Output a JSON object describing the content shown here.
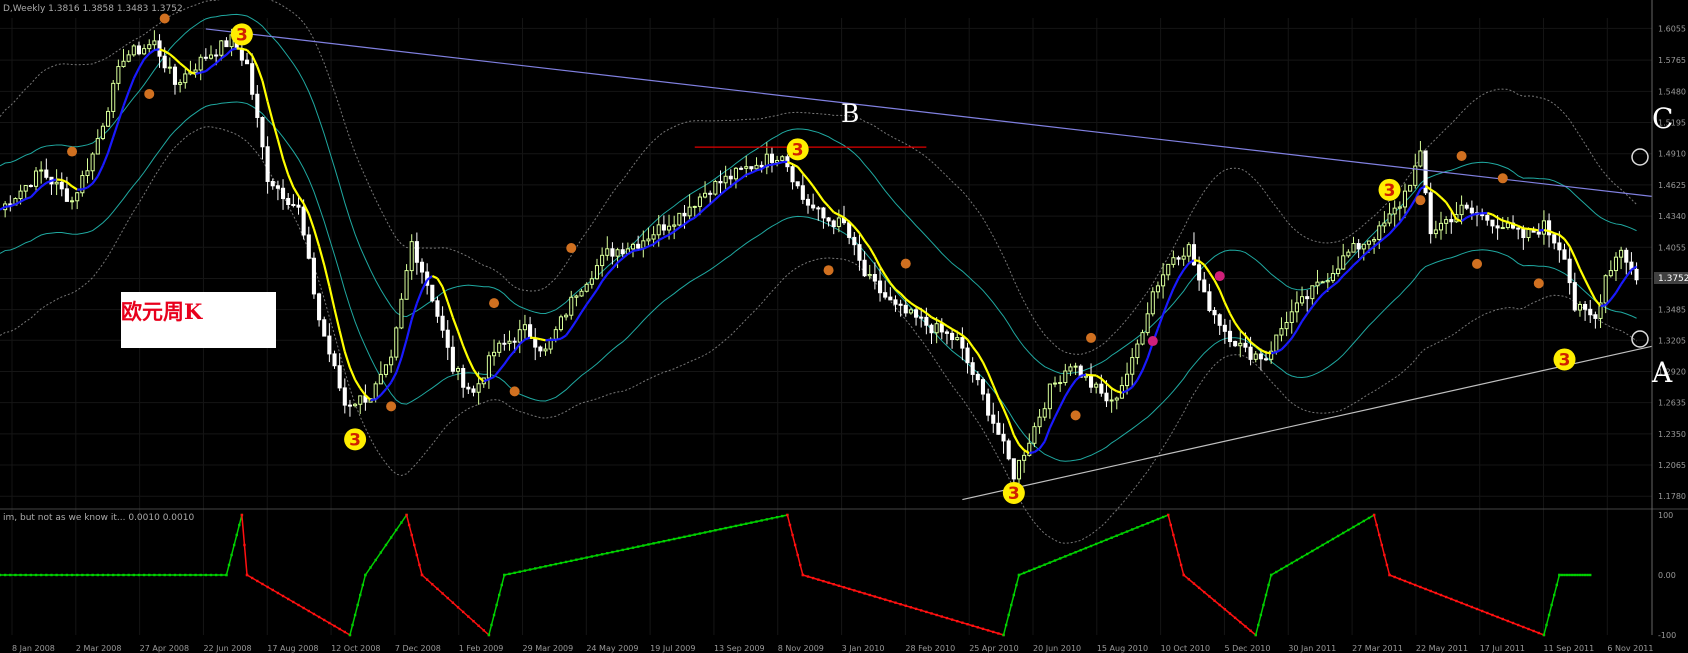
{
  "symbol_header": "D,Weekly  1.3816 1.3858 1.3483 1.3752",
  "indicator_header": "im, but not as we know it... 0.0010 0.0010",
  "annotation_box": "欧元周K",
  "labels": {
    "A": "A",
    "B": "B",
    "C": "C"
  },
  "pivot_marker_text": "3",
  "colors": {
    "background": "#000000",
    "bull_candle": "#d8ff9a",
    "bear_candle": "#ffffff",
    "ma_rising": "#1a1aff",
    "ma_falling": "#ffff00",
    "envelope": "#1fa8a0",
    "bollinger": "#777777",
    "resistance_trendline": "#8080e0",
    "support_trendline": "#c0c0c0",
    "b_level_line": "#e00000",
    "osc_up": "#00d000",
    "osc_down": "#ff1010",
    "price_label_box": "#404040"
  },
  "chart_data": [
    {
      "type": "candlestick",
      "panel": "price",
      "ylim": [
        1.17,
        1.615
      ],
      "y_ticks": [
        "1.6055",
        "1.5765",
        "1.5480",
        "1.5195",
        "1.4910",
        "1.4625",
        "1.4340",
        "1.4055",
        "1.3770",
        "1.3485",
        "1.3205",
        "1.2920",
        "1.2635",
        "1.2350",
        "1.2065",
        "1.1780"
      ],
      "current_price_label": "1.3752",
      "x_tick_labels": [
        "8 Jan 2008",
        "2 Mar 2008",
        "27 Apr 2008",
        "22 Jun 2008",
        "17 Aug 2008",
        "12 Oct 2008",
        "7 Dec 2008",
        "1 Feb 2009",
        "29 Mar 2009",
        "24 May 2009",
        "19 Jul 2009",
        "13 Sep 2009",
        "8 Nov 2009",
        "3 Jan 2010",
        "28 Feb 2010",
        "25 Apr 2010",
        "20 Jun 2010",
        "15 Aug 2010",
        "10 Oct 2010",
        "5 Dec 2010",
        "30 Jan 2011",
        "27 Mar 2011",
        "22 May 2011",
        "17 Jul 2011",
        "11 Sep 2011",
        "6 Nov 2011"
      ],
      "close_path": [
        {
          "week": 0,
          "close": 1.44
        },
        {
          "week": 8,
          "close": 1.475
        },
        {
          "week": 14,
          "close": 1.448
        },
        {
          "week": 18,
          "close": 1.49
        },
        {
          "week": 24,
          "close": 1.58
        },
        {
          "week": 30,
          "close": 1.592
        },
        {
          "week": 34,
          "close": 1.555
        },
        {
          "week": 40,
          "close": 1.58
        },
        {
          "week": 45,
          "close": 1.595
        },
        {
          "week": 48,
          "close": 1.572
        },
        {
          "week": 52,
          "close": 1.47
        },
        {
          "week": 58,
          "close": 1.44
        },
        {
          "week": 62,
          "close": 1.34
        },
        {
          "week": 67,
          "close": 1.262
        },
        {
          "week": 72,
          "close": 1.27
        },
        {
          "week": 76,
          "close": 1.3
        },
        {
          "week": 80,
          "close": 1.41
        },
        {
          "week": 84,
          "close": 1.36
        },
        {
          "week": 88,
          "close": 1.295
        },
        {
          "week": 92,
          "close": 1.272
        },
        {
          "week": 96,
          "close": 1.31
        },
        {
          "week": 102,
          "close": 1.33
        },
        {
          "week": 106,
          "close": 1.31
        },
        {
          "week": 112,
          "close": 1.365
        },
        {
          "week": 118,
          "close": 1.4
        },
        {
          "week": 124,
          "close": 1.41
        },
        {
          "week": 132,
          "close": 1.435
        },
        {
          "week": 138,
          "close": 1.46
        },
        {
          "week": 146,
          "close": 1.48
        },
        {
          "week": 152,
          "close": 1.492
        },
        {
          "week": 156,
          "close": 1.45
        },
        {
          "week": 160,
          "close": 1.432
        },
        {
          "week": 164,
          "close": 1.426
        },
        {
          "week": 168,
          "close": 1.38
        },
        {
          "week": 174,
          "close": 1.35
        },
        {
          "week": 180,
          "close": 1.335
        },
        {
          "week": 186,
          "close": 1.32
        },
        {
          "week": 190,
          "close": 1.28
        },
        {
          "week": 194,
          "close": 1.235
        },
        {
          "week": 197,
          "close": 1.198
        },
        {
          "week": 200,
          "close": 1.23
        },
        {
          "week": 204,
          "close": 1.275
        },
        {
          "week": 208,
          "close": 1.3
        },
        {
          "week": 212,
          "close": 1.28
        },
        {
          "week": 216,
          "close": 1.262
        },
        {
          "week": 220,
          "close": 1.3
        },
        {
          "week": 224,
          "close": 1.365
        },
        {
          "week": 228,
          "close": 1.398
        },
        {
          "week": 231,
          "close": 1.405
        },
        {
          "week": 234,
          "close": 1.36
        },
        {
          "week": 238,
          "close": 1.33
        },
        {
          "week": 242,
          "close": 1.31
        },
        {
          "week": 246,
          "close": 1.305
        },
        {
          "week": 250,
          "close": 1.34
        },
        {
          "week": 256,
          "close": 1.37
        },
        {
          "week": 262,
          "close": 1.4
        },
        {
          "week": 268,
          "close": 1.42
        },
        {
          "week": 272,
          "close": 1.445
        },
        {
          "week": 276,
          "close": 1.488
        },
        {
          "week": 278,
          "close": 1.42
        },
        {
          "week": 284,
          "close": 1.44
        },
        {
          "week": 290,
          "close": 1.43
        },
        {
          "week": 296,
          "close": 1.415
        },
        {
          "week": 300,
          "close": 1.425
        },
        {
          "week": 304,
          "close": 1.4
        },
        {
          "week": 306,
          "close": 1.35
        },
        {
          "week": 310,
          "close": 1.34
        },
        {
          "week": 312,
          "close": 1.38
        },
        {
          "week": 315,
          "close": 1.405
        },
        {
          "week": 318,
          "close": 1.375
        }
      ],
      "pivots_3": [
        {
          "week": 47,
          "price": 1.6,
          "type": "high"
        },
        {
          "week": 69,
          "price": 1.23,
          "type": "low"
        },
        {
          "week": 155,
          "price": 1.495,
          "type": "high"
        },
        {
          "week": 197,
          "price": 1.181,
          "type": "low"
        },
        {
          "week": 270,
          "price": 1.458,
          "type": "high"
        },
        {
          "week": 304,
          "price": 1.303,
          "type": "low"
        }
      ],
      "trendlines": [
        {
          "name": "resistance",
          "from": {
            "week": 40,
            "price": 1.605
          },
          "to": {
            "week": 321,
            "price": 1.452
          }
        },
        {
          "name": "support",
          "from": {
            "week": 187,
            "price": 1.175
          },
          "to": {
            "week": 321,
            "price": 1.315
          }
        },
        {
          "name": "B-level",
          "from": {
            "week": 135,
            "price": 1.497
          },
          "to": {
            "week": 180,
            "price": 1.497
          }
        }
      ]
    },
    {
      "type": "line",
      "panel": "oscillator",
      "ylim": [
        -100,
        100
      ],
      "y_ticks": [
        "100",
        "0.00",
        "-100"
      ],
      "series": [
        {
          "segments": [
            [
              0,
              0
            ],
            [
              44,
              0
            ],
            [
              47,
              100
            ],
            [
              48,
              0
            ],
            [
              68,
              -100
            ],
            [
              71,
              0
            ],
            [
              79,
              100
            ],
            [
              82,
              0
            ],
            [
              95,
              -100
            ],
            [
              98,
              0
            ],
            [
              153,
              100
            ],
            [
              156,
              0
            ],
            [
              195,
              -100
            ],
            [
              198,
              0
            ],
            [
              227,
              100
            ],
            [
              230,
              0
            ],
            [
              244,
              -100
            ],
            [
              247,
              0
            ],
            [
              267,
              100
            ],
            [
              270,
              0
            ],
            [
              300,
              -100
            ],
            [
              303,
              0
            ],
            [
              309,
              0
            ]
          ]
        }
      ]
    }
  ]
}
